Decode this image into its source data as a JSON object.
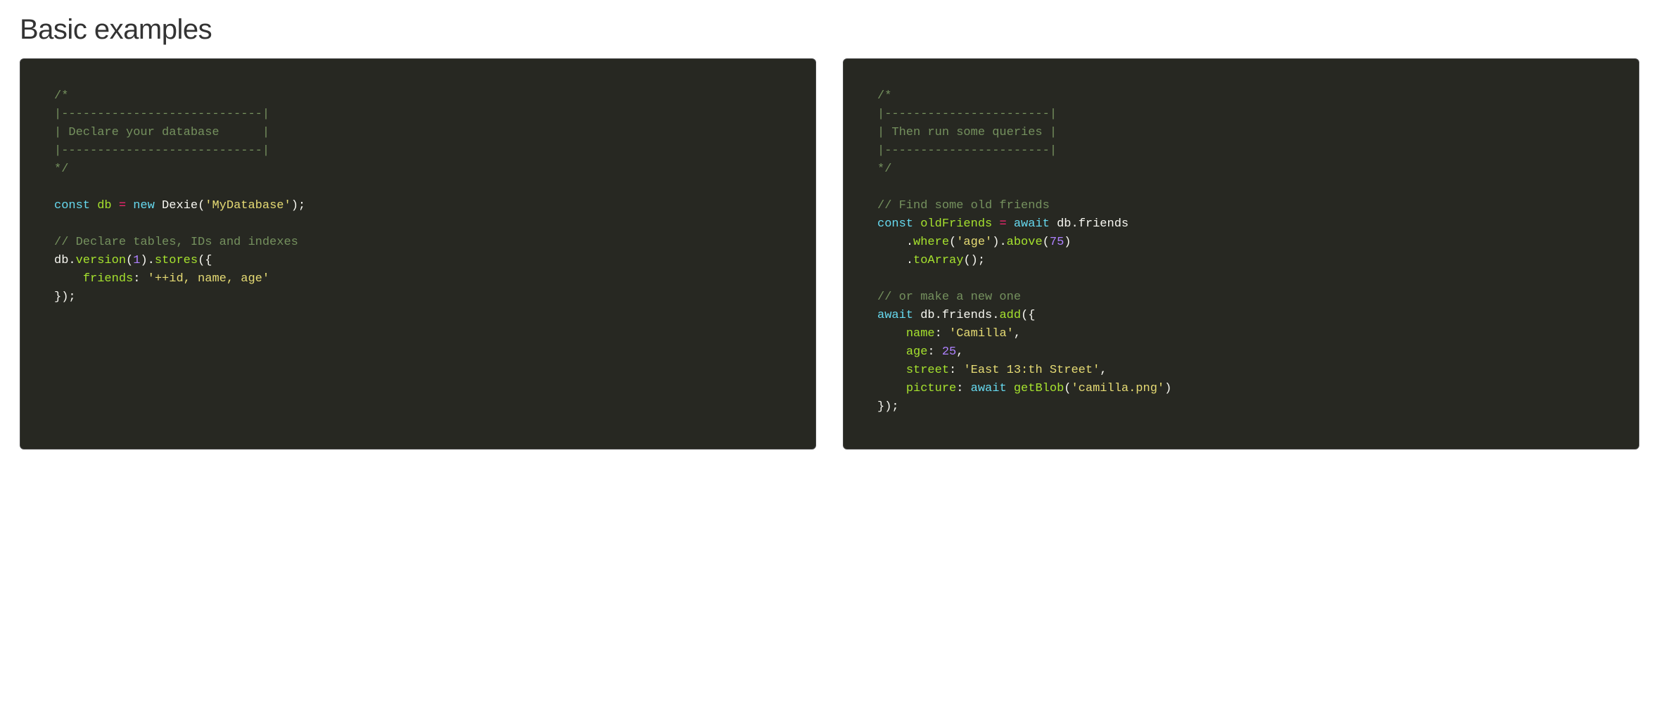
{
  "heading": "Basic examples",
  "left": {
    "c1_l1": "/*",
    "c1_l2": "|----------------------------|",
    "c1_l3": "| Declare your database      |",
    "c1_l4": "|----------------------------|",
    "c1_l5": "*/",
    "kw_const": "const",
    "id_db": "db",
    "op_eq": "=",
    "kw_new": "new",
    "fn_dexie": "Dexie",
    "s_mydb": "'MyDatabase'",
    "p_close_paren_semi": ");",
    "c2": "// Declare tables, IDs and indexes",
    "id_db2": "db",
    "p_dot1": ".",
    "fn_version": "version",
    "p_open_paren": "(",
    "n_1": "1",
    "p_close_paren": ")",
    "p_dot2": ".",
    "fn_stores": "stores",
    "p_open_brace": "({",
    "indent": "    ",
    "attr_friends": "friends",
    "p_colon": ":",
    "s_schema": "'++id, name, age'",
    "p_close_brace": "});"
  },
  "right": {
    "c1_l1": "/*",
    "c1_l2": "|-----------------------|",
    "c1_l3": "| Then run some queries |",
    "c1_l4": "|-----------------------|",
    "c1_l5": "*/",
    "c2": "// Find some old friends",
    "kw_const": "const",
    "id_old": "oldFriends",
    "op_eq": "=",
    "kw_await1": "await",
    "id_db": "db",
    "p_dot": ".",
    "id_friends": "friends",
    "indent": "    ",
    "p_dot_where": ".",
    "fn_where": "where",
    "p_open": "(",
    "s_age": "'age'",
    "p_close": ")",
    "p_dot_above": ".",
    "fn_above": "above",
    "n_75": "75",
    "p_dot_toArray": ".",
    "fn_toArray": "toArray",
    "p_empty_call_semi": "();",
    "c3": "// or make a new one",
    "kw_await2": "await",
    "id_db2": "db",
    "id_friends2": "friends",
    "fn_add": "add",
    "p_open_brace": "({",
    "attr_name": "name",
    "p_colon": ":",
    "s_camilla": "'Camilla'",
    "p_comma": ",",
    "attr_age": "age",
    "n_25": "25",
    "attr_street": "street",
    "s_street": "'East 13:th Street'",
    "attr_picture": "picture",
    "kw_await3": "await",
    "fn_getBlob": "getBlob",
    "s_png": "'camilla.png'",
    "p_close_brace": "});"
  }
}
